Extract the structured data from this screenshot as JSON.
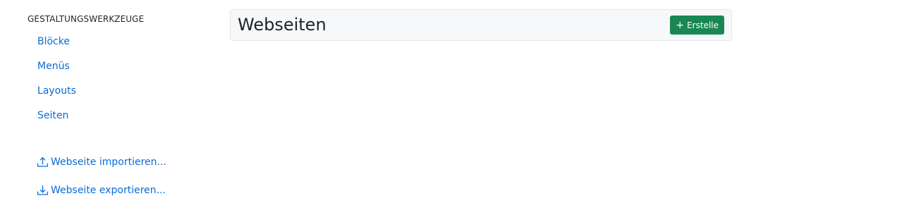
{
  "sidebar": {
    "heading": "GESTALTUNGSWERKZEUGE",
    "items": [
      {
        "label": "Blöcke"
      },
      {
        "label": "Menüs"
      },
      {
        "label": "Layouts"
      },
      {
        "label": "Seiten"
      }
    ],
    "actions": {
      "import_label": "Webseite importieren...",
      "import_icon": "upload-icon",
      "export_label": "Webseite exportieren...",
      "export_icon": "download-icon"
    }
  },
  "main": {
    "title": "Webseiten",
    "create_button_label": "Erstelle",
    "create_button_icon": "plus-icon"
  },
  "colors": {
    "link": "#0b6bd8",
    "primary_button": "#198754",
    "card_background": "#f7f8fa"
  }
}
